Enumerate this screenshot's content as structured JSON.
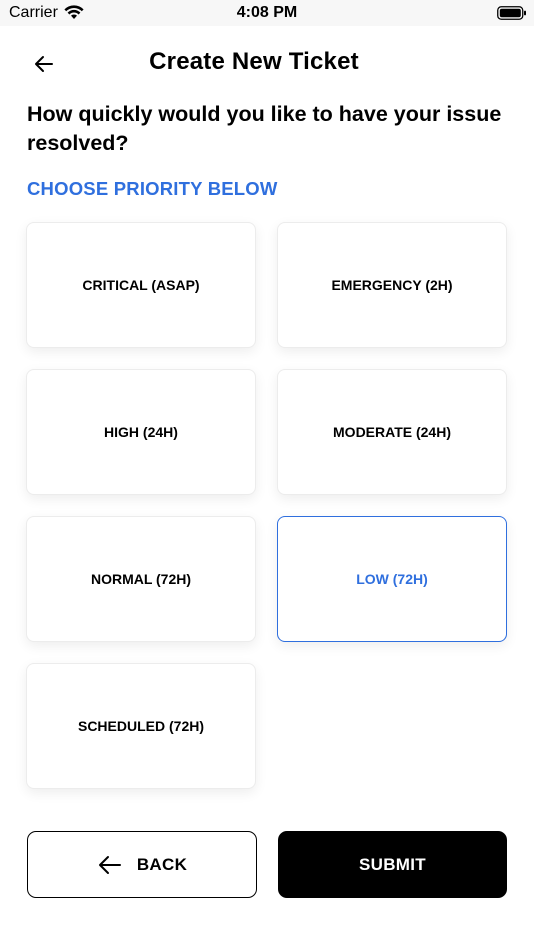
{
  "status_bar": {
    "carrier": "Carrier",
    "time": "4:08 PM",
    "wifi_icon": "wifi-icon",
    "battery_icon": "battery-icon"
  },
  "header": {
    "title": "Create New Ticket",
    "back_icon": "arrow-left-icon"
  },
  "main": {
    "question": "How quickly would you like to have your issue resolved?",
    "section_label": "CHOOSE PRIORITY BELOW",
    "priorities": [
      {
        "label": "CRITICAL (ASAP)",
        "selected": false
      },
      {
        "label": "EMERGENCY (2H)",
        "selected": false
      },
      {
        "label": "HIGH (24H)",
        "selected": false
      },
      {
        "label": "MODERATE (24H)",
        "selected": false
      },
      {
        "label": "NORMAL (72H)",
        "selected": false
      },
      {
        "label": "LOW (72H)",
        "selected": true
      },
      {
        "label": "SCHEDULED (72H)",
        "selected": false
      }
    ]
  },
  "footer": {
    "back_label": "BACK",
    "submit_label": "SUBMIT"
  },
  "colors": {
    "accent": "#2f6fde",
    "primary_button": "#000000",
    "status_bar_bg": "#f7f7f7"
  }
}
